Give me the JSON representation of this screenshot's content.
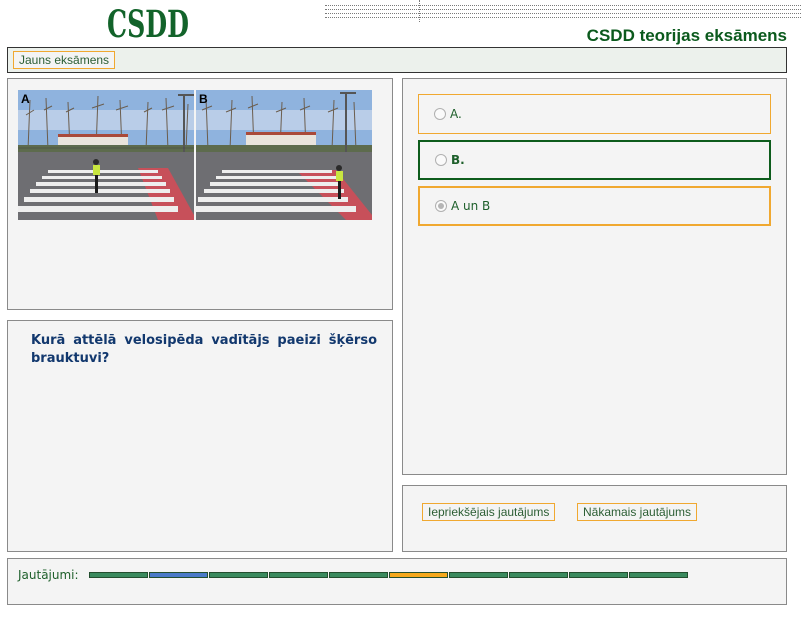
{
  "header": {
    "logo_text": "CSDD",
    "title": "CSDD teorijas eksāmens"
  },
  "toolbar": {
    "new_exam_label": "Jauns eksāmens"
  },
  "images": [
    {
      "label": "A"
    },
    {
      "label": "B"
    }
  ],
  "question": {
    "text": "Kurā attēlā velosipēda vadītājs paeizi šķērso brauktuvi?"
  },
  "answers": [
    {
      "label": "A.",
      "checked": false
    },
    {
      "label": "B.",
      "checked": false
    },
    {
      "label": "A un B",
      "checked": true
    }
  ],
  "navigation": {
    "prev_label": "Iepriekšējais jautājums",
    "next_label": "Nākamais jautājums"
  },
  "progress": {
    "label": "Jautājumi:",
    "segments": [
      "answered",
      "current",
      "answered",
      "answered",
      "answered",
      "unanswered",
      "answered",
      "answered",
      "answered",
      "answered"
    ],
    "colors": {
      "answered": "#3a8a5e",
      "current": "#4a7ac8",
      "unanswered": "#f5a81c"
    }
  }
}
